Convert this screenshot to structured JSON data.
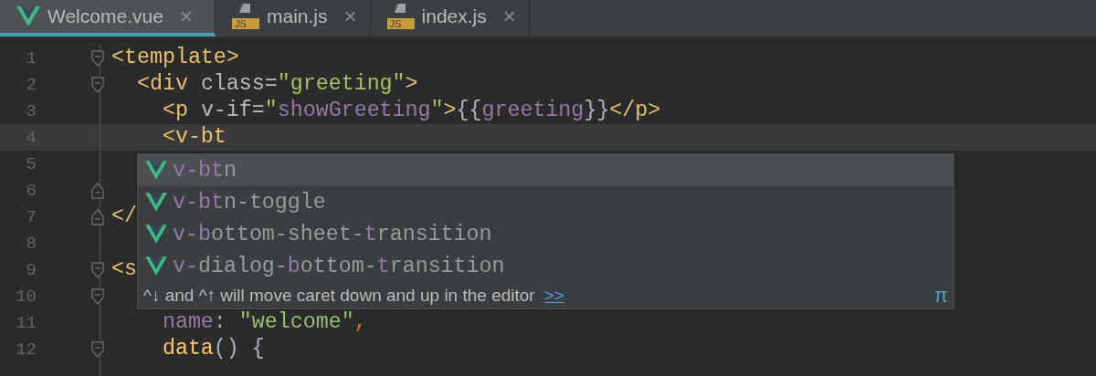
{
  "tabs": [
    {
      "label": "Welcome.vue",
      "kind": "vue",
      "selected": true,
      "close": "×"
    },
    {
      "label": "main.js",
      "kind": "js",
      "icon_text": "JS",
      "selected": false,
      "close": "×"
    },
    {
      "label": "index.js",
      "kind": "js",
      "icon_text": "JS",
      "selected": false,
      "close": "×"
    }
  ],
  "editor": {
    "lines": [
      {
        "number": "1",
        "kind": "fold-start",
        "current": false,
        "tokens": [
          {
            "kind": "tag",
            "text": "<template>"
          }
        ]
      },
      {
        "number": "2",
        "kind": "fold-start",
        "current": false,
        "tokens": [
          {
            "kind": "tag",
            "text": "  <div "
          },
          {
            "kind": "attr",
            "text": "class="
          },
          {
            "kind": "string",
            "text": "\"greeting\""
          },
          {
            "kind": "tag",
            "text": ">"
          }
        ]
      },
      {
        "number": "3",
        "kind": "plain",
        "current": false,
        "tokens": [
          {
            "kind": "tag",
            "text": "    <p "
          },
          {
            "kind": "attr",
            "text": "v-if="
          },
          {
            "kind": "string",
            "text": "\""
          },
          {
            "kind": "expr",
            "text": "showGreeting"
          },
          {
            "kind": "string",
            "text": "\""
          },
          {
            "kind": "tag",
            "text": ">"
          },
          {
            "kind": "plain",
            "text": "{{"
          },
          {
            "kind": "expr",
            "text": "greeting"
          },
          {
            "kind": "plain",
            "text": "}}"
          },
          {
            "kind": "tag",
            "text": "</p>"
          }
        ]
      },
      {
        "number": "4",
        "kind": "plain",
        "current": true,
        "tokens": [
          {
            "kind": "tag",
            "text": "    <v-bt"
          }
        ]
      },
      {
        "number": "5",
        "kind": "plain",
        "current": false
      },
      {
        "number": "6",
        "kind": "fold-end",
        "current": false
      },
      {
        "number": "7",
        "kind": "fold-end",
        "current": false,
        "tokens": [
          {
            "kind": "tag",
            "text": "</"
          }
        ]
      },
      {
        "number": "8",
        "kind": "plain",
        "current": false
      },
      {
        "number": "9",
        "kind": "fold-start",
        "current": false,
        "tokens": [
          {
            "kind": "tag",
            "text": "<s"
          }
        ]
      },
      {
        "number": "10",
        "kind": "fold-start",
        "current": false
      },
      {
        "number": "11",
        "kind": "plain",
        "current": false,
        "tokens": [
          {
            "kind": "expr",
            "text": "    name"
          },
          {
            "kind": "plain",
            "text": ": "
          },
          {
            "kind": "jsstring",
            "text": "\"welcome\""
          },
          {
            "kind": "punct",
            "text": ","
          }
        ]
      },
      {
        "number": "12",
        "kind": "fold-start",
        "current": false,
        "tokens": [
          {
            "kind": "func",
            "text": "    data"
          },
          {
            "kind": "plain",
            "text": "() {"
          }
        ]
      }
    ]
  },
  "completion": {
    "items": [
      {
        "selected": true,
        "parts": [
          {
            "text": "v-bt",
            "match": true
          },
          {
            "text": "n",
            "match": false
          }
        ]
      },
      {
        "selected": false,
        "parts": [
          {
            "text": "v-bt",
            "match": true
          },
          {
            "text": "n-toggle",
            "match": false
          }
        ]
      },
      {
        "selected": false,
        "parts": [
          {
            "text": "v-b",
            "match": true
          },
          {
            "text": "ottom-sheet-",
            "match": false
          },
          {
            "text": "t",
            "match": true
          },
          {
            "text": "ransition",
            "match": false
          }
        ]
      },
      {
        "selected": false,
        "parts": [
          {
            "text": "v-",
            "match": true
          },
          {
            "text": "dialog-",
            "match": false
          },
          {
            "text": "b",
            "match": true
          },
          {
            "text": "ottom-",
            "match": false
          },
          {
            "text": "t",
            "match": true
          },
          {
            "text": "ransition",
            "match": false
          }
        ]
      }
    ],
    "hint": "^↓ and ^↑ will move caret down and up in the editor",
    "hint_link": ">>",
    "pi": "π"
  }
}
